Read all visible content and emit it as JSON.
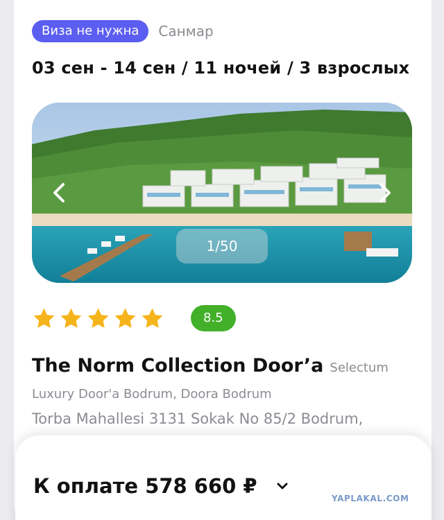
{
  "header": {
    "visa_badge": "Виза не нужна",
    "operator": "Санмар",
    "dates": "03 сен - 14 сен / 11 ночей / 3 взрослых"
  },
  "gallery": {
    "counter": "1/50",
    "icons": {
      "prev": "chevron-left-icon",
      "next": "chevron-right-icon"
    }
  },
  "rating": {
    "stars": 5,
    "score": "8.5",
    "colors": {
      "star": "#f6b41c",
      "score_bg": "#43b02a"
    }
  },
  "hotel": {
    "name": "The Norm Collection Door’a",
    "brand": "Selectum",
    "subtitle": "Luxury Door'a Bodrum, Doora Bodrum",
    "address": "Torba Mahallesi 3131 Sokak No 85/2 Bodrum,"
  },
  "payment": {
    "label": "К оплате 578 660 ₽",
    "icon": "chevron-down-icon"
  },
  "watermark": "YAPLAKAL.COM",
  "colors": {
    "accent": "#5b5ef0",
    "muted": "#8b8b93",
    "text": "#121212"
  }
}
